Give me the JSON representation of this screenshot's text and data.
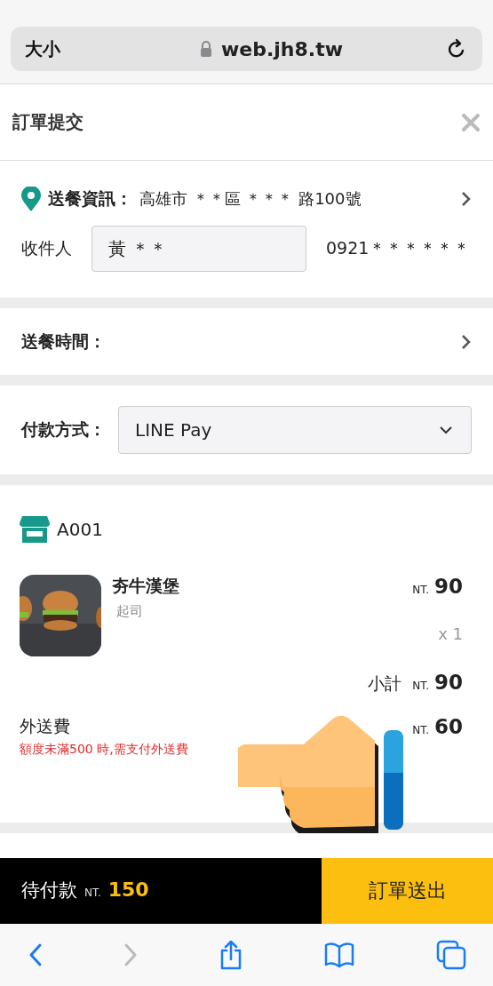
{
  "browser": {
    "text_size": "大小",
    "url": "web.jh8.tw"
  },
  "header": {
    "title": "訂單提交"
  },
  "delivery": {
    "label": "送餐資訊：",
    "address": "高雄市 ＊＊區 ＊＊＊ 路100號",
    "recipient_label": "收件人",
    "recipient_value": "黃 ＊＊",
    "phone": "0921＊＊＊＊＊＊"
  },
  "delivery_time": {
    "label": "送餐時間："
  },
  "payment": {
    "label": "付款方式：",
    "value": "LINE Pay"
  },
  "store": {
    "name": "A001"
  },
  "items": [
    {
      "name": "夯牛漢堡",
      "option": "起司",
      "currency": "NT.",
      "price": "90",
      "quantity": "x 1"
    }
  ],
  "subtotal": {
    "label": "小計",
    "currency": "NT.",
    "amount": "90"
  },
  "delivery_fee": {
    "label": "外送費",
    "note": "額度未滿500 時,需支付外送費",
    "currency": "NT.",
    "amount": "60"
  },
  "footer": {
    "label": "待付款",
    "currency": "NT.",
    "amount": "150",
    "submit": "訂單送出"
  },
  "toolbar": [
    {
      "kind": "back",
      "disabled": false
    },
    {
      "kind": "forward",
      "disabled": true
    },
    {
      "kind": "share",
      "disabled": false
    },
    {
      "kind": "bookmarks",
      "disabled": false
    },
    {
      "kind": "tabs",
      "disabled": false
    }
  ]
}
